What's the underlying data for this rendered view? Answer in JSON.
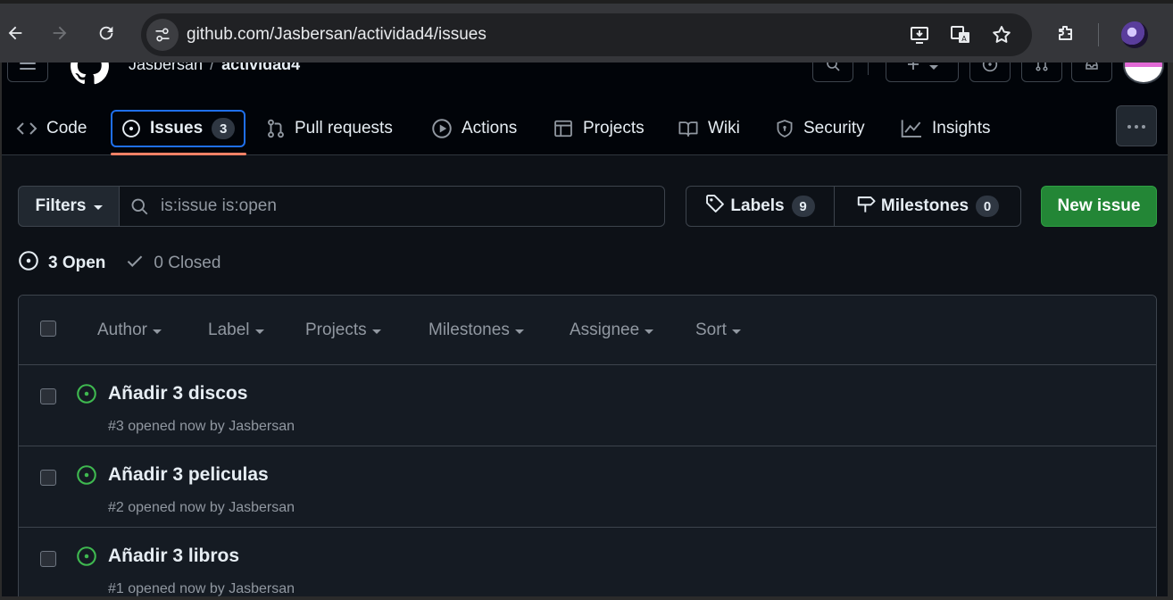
{
  "browser": {
    "url": "github.com/Jasbersan/actividad4/issues",
    "icons": [
      "back-icon",
      "forward-icon",
      "reload-icon",
      "site-info-icon",
      "install-app-icon",
      "translate-icon",
      "bookmark-star-icon",
      "extensions-icon",
      "profile-avatar"
    ]
  },
  "repo": {
    "owner": "Jasbersan",
    "separator": "/",
    "name": "actividad4"
  },
  "tabs": [
    {
      "label": "Code",
      "icon": "code-icon"
    },
    {
      "label": "Issues",
      "icon": "issue-opened-icon",
      "count": "3",
      "selected": true
    },
    {
      "label": "Pull requests",
      "icon": "git-pull-request-icon"
    },
    {
      "label": "Actions",
      "icon": "play-icon"
    },
    {
      "label": "Projects",
      "icon": "table-icon"
    },
    {
      "label": "Wiki",
      "icon": "book-icon"
    },
    {
      "label": "Security",
      "icon": "shield-icon"
    },
    {
      "label": "Insights",
      "icon": "graph-icon"
    }
  ],
  "toolbar": {
    "filters_label": "Filters",
    "search_value": "is:issue is:open",
    "labels_label": "Labels",
    "labels_count": "9",
    "milestones_label": "Milestones",
    "milestones_count": "0",
    "new_issue_label": "New issue"
  },
  "states": {
    "open_label": "3 Open",
    "closed_label": "0 Closed"
  },
  "list_header": {
    "filters": [
      "Author",
      "Label",
      "Projects",
      "Milestones",
      "Assignee",
      "Sort"
    ]
  },
  "issues": [
    {
      "title": "Añadir 3 discos",
      "meta": "#3 opened now by Jasbersan"
    },
    {
      "title": "Añadir 3 peliculas",
      "meta": "#2 opened now by Jasbersan"
    },
    {
      "title": "Añadir 3 libros",
      "meta": "#1 opened now by Jasbersan"
    }
  ],
  "colors": {
    "accent_green": "#238636",
    "open_icon": "#3fb950",
    "tab_underline": "#f78166",
    "focus_blue": "#1f6feb"
  }
}
